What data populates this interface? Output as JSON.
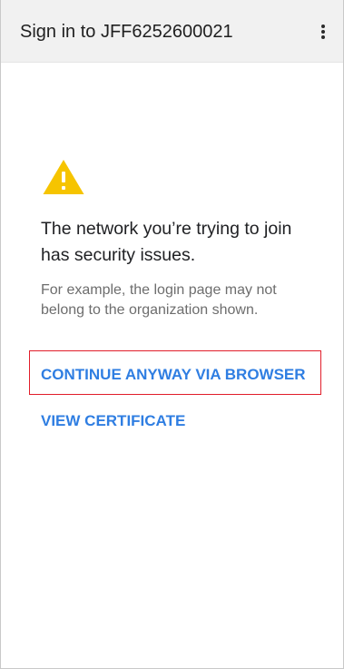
{
  "app_bar": {
    "title": "Sign in to JFF6252600021",
    "overflow_icon": "more-vertical-icon"
  },
  "warning": {
    "icon": "warning-triangle-icon",
    "icon_color": "#F6C400",
    "mark_color": "#FFFFFF"
  },
  "message": {
    "headline": "The network you’re trying to join has security issues.",
    "detail": "For example, the login page may not belong to the organization shown."
  },
  "actions": {
    "continue_label": "CONTINUE ANYWAY VIA BROWSER",
    "certificate_label": "VIEW CERTIFICATE",
    "link_color": "#2F7EE2",
    "highlight_color": "#E11D2A"
  }
}
